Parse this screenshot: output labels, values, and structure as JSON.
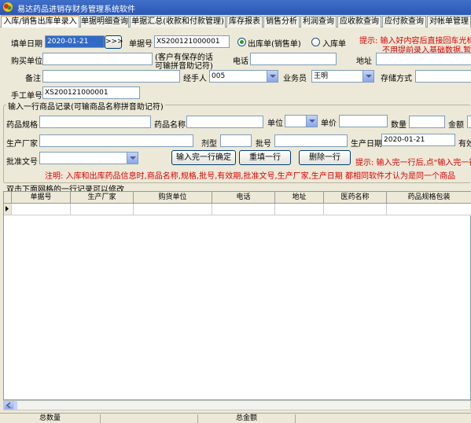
{
  "window": {
    "title": "易达药品进销存财务管理系统软件"
  },
  "tabs": [
    {
      "label": "入库/销售出库单录入"
    },
    {
      "label": "单据明细查询"
    },
    {
      "label": "单据汇总(收款和付款管理)"
    },
    {
      "label": "库存报表"
    },
    {
      "label": "销售分析"
    },
    {
      "label": "利润查询"
    },
    {
      "label": "应收款查询"
    },
    {
      "label": "应付款查询"
    },
    {
      "label": "对帐单管理"
    }
  ],
  "form": {
    "date_label": "填单日期",
    "date_value": "2020-01-21",
    "date_button": ">>>",
    "doc_no_label": "单据号",
    "doc_no_value": "XS200121000001",
    "radio_out": "出库单(销售单)",
    "radio_in": "入库单",
    "hint1": "提示: 输入好内容后直接回车光标",
    "hint2": "不用提前录入基础数据,暂存",
    "buyer_label": "购买单位",
    "buyer_note1": "(客户有保存的话",
    "buyer_note2": "可输拼音助记符)",
    "phone_label": "电话",
    "address_label": "地址",
    "remark_label": "备注",
    "handler_label": "经手人",
    "handler_value": "005",
    "salesman_label": "业务员",
    "salesman_value": "王明",
    "storage_label": "存储方式",
    "manual_no_label": "手工单号",
    "manual_no_value": "XS200121000001"
  },
  "item_section": {
    "title": "输入一行商品记录(可输商品名称拼音助记符)",
    "spec_label": "药品规格",
    "name_label": "药品名称",
    "unit_label": "单位",
    "price_label": "单价",
    "qty_label": "数量",
    "amount_label": "金额",
    "maker_label": "生产厂家",
    "form_label": "剂型",
    "batch_label": "批号",
    "prod_date_label": "生产日期",
    "prod_date_value": "2020-01-21",
    "expire_label": "有效",
    "approval_label": "批准文号",
    "confirm_button": "输入完一行确定",
    "reset_button": "重填一行",
    "delete_button": "删除一行",
    "hint": "提示: 输入完一行后,点\"输入完一行",
    "note": "注明: 入库和出库药品信息时,商品名称,规格,批号,有效期,批准文号,生产厂家,生产日期 都相同软件才认为是同一个商品"
  },
  "grid": {
    "caption": "双击下面网格的一行记录可以修改",
    "columns": [
      "单据号",
      "生产厂家",
      "购货单位",
      "电话",
      "地址",
      "医药名称",
      "药品规格包装"
    ]
  },
  "status": {
    "total_qty_label": "总数量",
    "total_amount_label": "总金额"
  }
}
